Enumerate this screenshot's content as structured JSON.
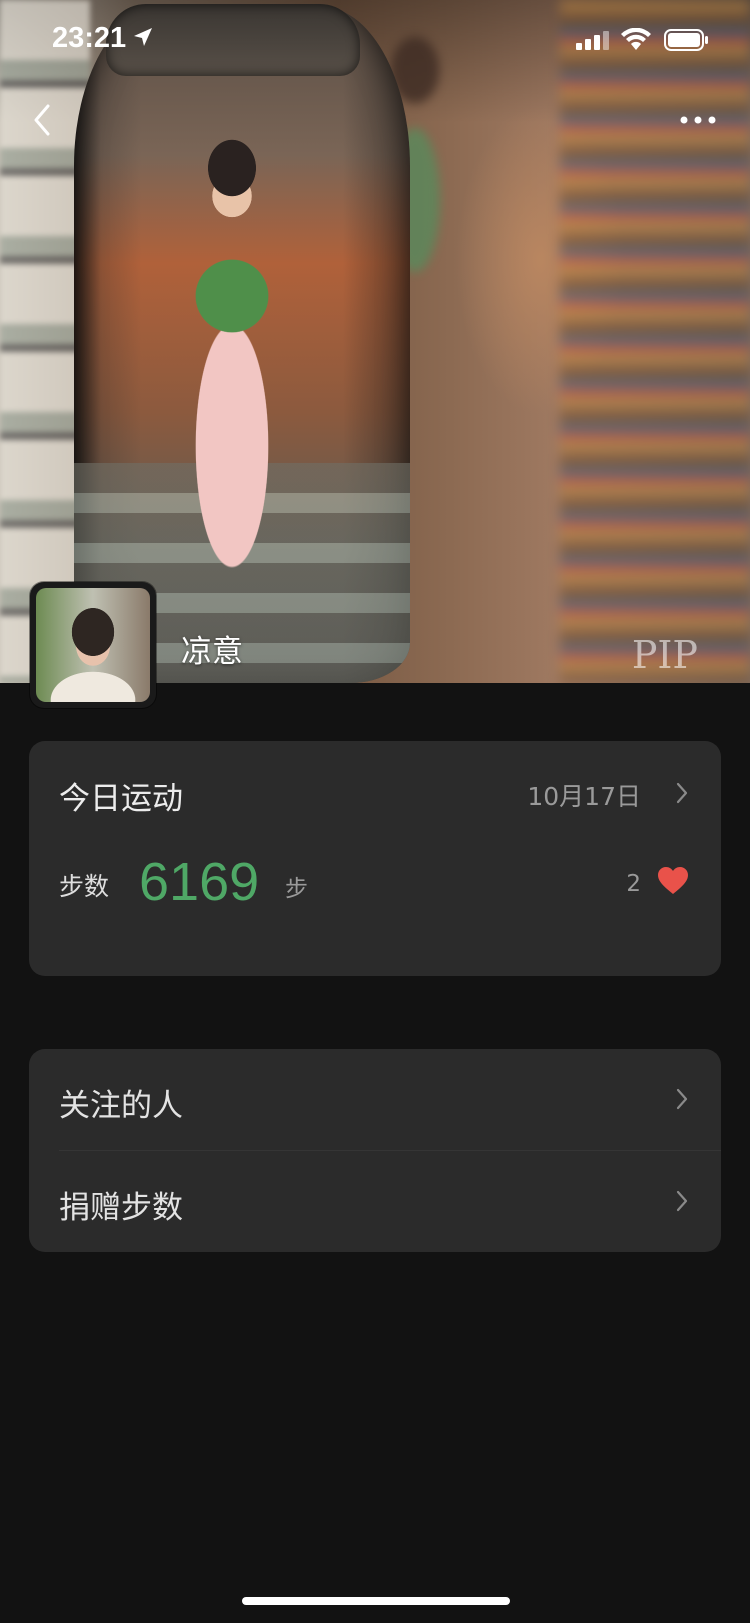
{
  "status_bar": {
    "time": "23:21"
  },
  "header": {
    "back_icon": "chevron-left-icon",
    "more_icon": "more-dots-icon"
  },
  "profile": {
    "name": "凉意",
    "watermark": "PIP"
  },
  "today_sport": {
    "title": "今日运动",
    "date": "10月17日",
    "steps_label": "步数",
    "steps_value": "6169",
    "steps_unit": "步",
    "likes_count": "2",
    "accent_color": "#4fa866",
    "heart_color": "#e9524a"
  },
  "menu": {
    "items": [
      {
        "label": "关注的人"
      },
      {
        "label": "捐赠步数"
      }
    ]
  }
}
